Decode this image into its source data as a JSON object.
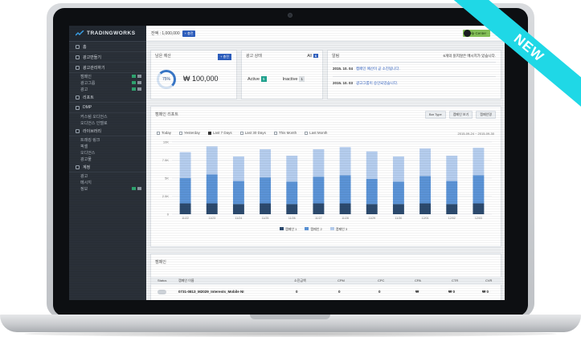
{
  "brand": {
    "name": "TRADINGWORKS"
  },
  "badge": {
    "label": "NEW",
    "color": "#1fd8e6"
  },
  "sidebar": {
    "sections": [
      {
        "label": "홈",
        "icon": "home-icon",
        "items": []
      },
      {
        "label": "광고만들기",
        "icon": "monitor-icon",
        "items": []
      },
      {
        "label": "광고관리하기",
        "icon": "list-icon",
        "items": [
          {
            "label": "캠페인",
            "badges": true
          },
          {
            "label": "광고그룹",
            "badges": true
          },
          {
            "label": "광고",
            "badges": true
          }
        ]
      },
      {
        "label": "리포트",
        "icon": "chart-icon",
        "items": []
      },
      {
        "label": "DMP",
        "icon": "pencil-icon",
        "items": [
          {
            "label": "커스텀 오디언스",
            "badges": false
          },
          {
            "label": "오디언스 인텔로",
            "badges": false
          }
        ]
      },
      {
        "label": "라이브러리",
        "icon": "library-icon",
        "items": [
          {
            "label": "트래킹 링크",
            "badges": false
          },
          {
            "label": "픽셀",
            "badges": false
          },
          {
            "label": "오디언스",
            "badges": false
          },
          {
            "label": "광고물",
            "badges": false
          }
        ]
      },
      {
        "label": "계정",
        "icon": "user-icon",
        "items": [
          {
            "label": "광고",
            "badges": false
          },
          {
            "label": "메시지",
            "badges": false
          },
          {
            "label": "정보",
            "badges": true
          }
        ]
      }
    ]
  },
  "topbar": {
    "balance": "잔액 : 1,000,000",
    "charge_label": "+ 충전",
    "help_label": "Help Center"
  },
  "budget": {
    "title": "남은 예산",
    "charge_label": "+ 충전",
    "percent": "75%",
    "percent_value": 75,
    "amount": "₩ 100,000"
  },
  "ad_status": {
    "title": "광고 상태",
    "all_label": "All",
    "all_count": "6",
    "active_label": "Active",
    "active_count": "5",
    "inactive_label": "Inactive",
    "inactive_count": "1"
  },
  "notices": {
    "title": "알림",
    "summary": "6개의 읽지않은 메시지가 있습니다.",
    "items": [
      {
        "date": "2015. 10. 04",
        "text": "캠페인 예산이 곧 소진됩니다."
      },
      {
        "date": "2015. 10. 03",
        "text": "광고그룹이 승인되었습니다."
      }
    ]
  },
  "report": {
    "title": "캠페인 리포트",
    "controls": [
      "Bar Type",
      "캠페인 보기",
      "캠페인명"
    ],
    "date_range": "2015-09-24 ~ 2015-09-30",
    "ranges": [
      {
        "label": "Today",
        "checked": false
      },
      {
        "label": "Yesterday",
        "checked": false
      },
      {
        "label": "Last 7 Days",
        "checked": true
      },
      {
        "label": "Last 30 Days",
        "checked": false
      },
      {
        "label": "This Month",
        "checked": false
      },
      {
        "label": "Last Month",
        "checked": false
      }
    ]
  },
  "chart_data": {
    "type": "bar",
    "stacked": true,
    "categories": [
      "11/22",
      "11/23",
      "11/24",
      "11/25",
      "11/26",
      "11/27",
      "11/28",
      "11/29",
      "11/30",
      "12/01",
      "12/02",
      "12/03"
    ],
    "series": [
      {
        "name": "캠페인 1",
        "color": "#2c4a6e",
        "values": [
          1.5,
          1.5,
          1.4,
          1.5,
          1.4,
          1.5,
          1.5,
          1.4,
          1.4,
          1.5,
          1.4,
          1.5
        ]
      },
      {
        "name": "캠페인 2",
        "color": "#5b93d6",
        "values": [
          3.5,
          4.0,
          3.2,
          3.6,
          3.1,
          3.7,
          3.9,
          3.5,
          3.1,
          3.8,
          3.2,
          3.9
        ]
      },
      {
        "name": "캠페인 3",
        "color": "#b5cdee",
        "values": [
          3.6,
          3.9,
          3.4,
          3.9,
          3.6,
          3.8,
          3.9,
          3.8,
          3.5,
          3.8,
          3.5,
          3.8
        ]
      }
    ],
    "ytick_labels": [
      "0",
      "2.5K",
      "5K",
      "7.5K",
      "10K"
    ],
    "ylim": [
      0,
      10
    ]
  },
  "campaign": {
    "title": "캠페인",
    "columns": [
      "Status",
      "캠페인 이름",
      "소진금액",
      "CPM",
      "CPC",
      "CPA",
      "CTR",
      "CVR"
    ],
    "rows": [
      {
        "name": "0731-0813_M2029_Interests_Mobile NI",
        "spend": "0",
        "cpm": "0",
        "cpc": "0",
        "cpa": "₩",
        "ctr": "₩ 0",
        "cvr": "₩ 0"
      }
    ]
  }
}
